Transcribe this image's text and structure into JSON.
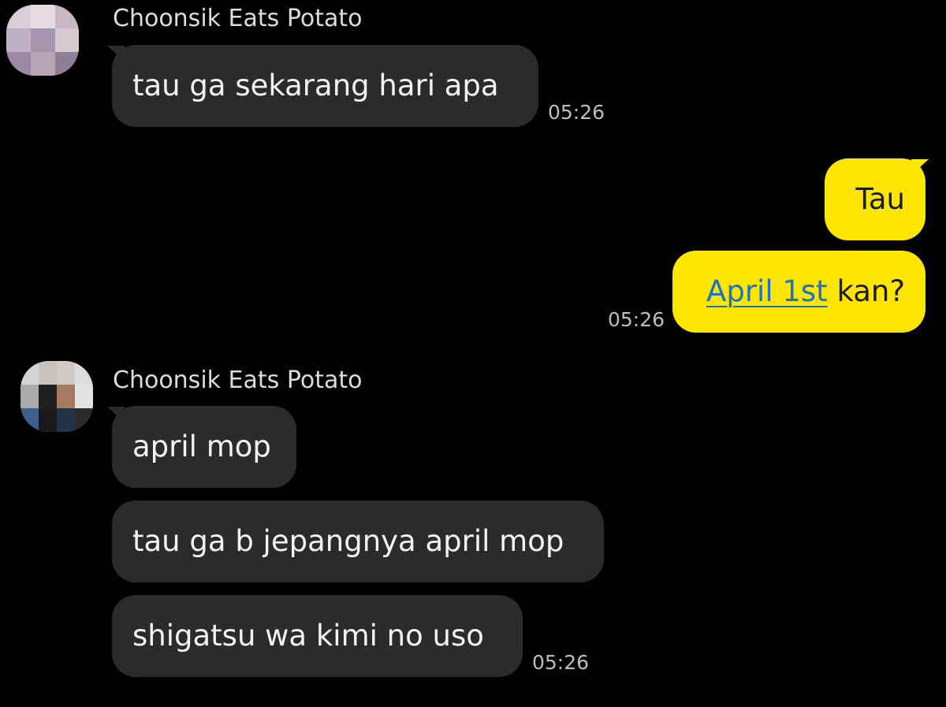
{
  "messages": {
    "group1": {
      "sender": "Choonsik Eats Potato",
      "text": "tau ga sekarang hari apa",
      "time": "05:26"
    },
    "group2": {
      "msg1": "Tau",
      "msg2_link": "April 1st",
      "msg2_rest": " kan?",
      "time": "05:26"
    },
    "group3": {
      "sender": "Choonsik Eats Potato",
      "msg1": "april mop",
      "msg2": "tau ga b jepangnya april mop",
      "msg3": "shigatsu wa kimi no uso",
      "time": "05:26"
    }
  },
  "colors": {
    "background": "#000000",
    "incoming_bubble": "#2b2b2b",
    "outgoing_bubble": "#ffe600",
    "link": "#1a73c8"
  }
}
